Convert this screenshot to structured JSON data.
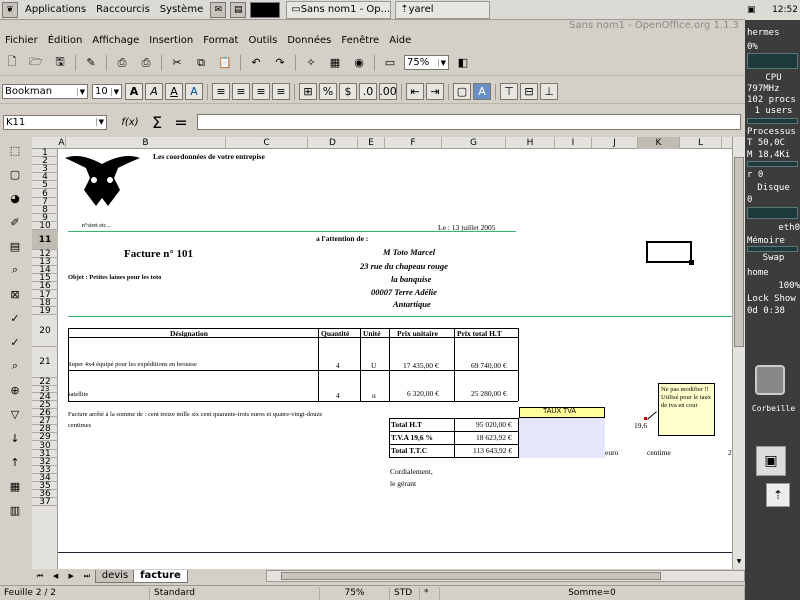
{
  "panel": {
    "menus": [
      "Applications",
      "Raccourcis",
      "Système"
    ],
    "tasks": [
      "Sans nom1 - Op...",
      "yarel"
    ],
    "clock": "12:52"
  },
  "window": {
    "title": "Sans nom1 - OpenOffice.org 1.1.3"
  },
  "menubar": [
    "Fichier",
    "Édition",
    "Affichage",
    "Insertion",
    "Format",
    "Outils",
    "Données",
    "Fenêtre",
    "Aide"
  ],
  "toolbar": {
    "zoom": "75%"
  },
  "format": {
    "font": "Bookman",
    "size": "10"
  },
  "formula": {
    "cellref": "K11",
    "func_label": "f(x)",
    "sigma": "Σ",
    "equals": "=",
    "content": ""
  },
  "columns": [
    "A",
    "B",
    "C",
    "D",
    "E",
    "F",
    "G",
    "H",
    "I",
    "J",
    "K",
    "L"
  ],
  "rows": [
    "1",
    "2",
    "3",
    "4",
    "5",
    "6",
    "7",
    "8",
    "9",
    "10",
    "11",
    "12",
    "13",
    "14",
    "15",
    "16",
    "17",
    "18",
    "19",
    "20",
    "21",
    "22",
    "23",
    "24",
    "25",
    "26",
    "27",
    "28",
    "29",
    "30",
    "31",
    "32",
    "33",
    "34",
    "35",
    "36",
    "37"
  ],
  "sheet": {
    "company": "Les coordonnées de votre entrepise",
    "small": "n°siret etc...",
    "date": "Le : 13 juillet 2005",
    "attention": "a l'attention de :",
    "invoice": "Facture n° 101",
    "client_name": "M Toto Marcel",
    "client_addr1": "23 rue du chapeau rouge",
    "client_addr2": "la banquise",
    "client_addr3": "00007  Terre Adélie",
    "client_addr4": "Antartique",
    "object": "Objet : Petites laines pour les toto",
    "headers": [
      "Désignation",
      "Quantité",
      "Unité",
      "Prix unitaire",
      "Prix total H.T"
    ],
    "items": [
      {
        "desc": "Super 4x4 équipé pour les expéditions en brousse",
        "qty": "4",
        "unit": "U",
        "price": "17 435,00 €",
        "total": "69 740,00 €"
      },
      {
        "desc": "satellite",
        "qty": "4",
        "unit": "u",
        "price": "6 320,00 €",
        "total": "25 280,00 €"
      }
    ],
    "amount_words_1": "Facture arrêté à la somme de :  cent treize mille six cent quarante-trois euros et  quatre-vingt-douze",
    "amount_words_2": "centimes",
    "totals": [
      {
        "label": "Total H.T",
        "value": "95 020,00 €"
      },
      {
        "label": "T.V.A  19,6 %",
        "value": "18 623,92 €"
      },
      {
        "label": "Total T.T.C",
        "value": "113 643,92 €"
      }
    ],
    "tva_header": "TAUX TVA",
    "tva_rate": "19,6",
    "euro": "euro",
    "centime": "centime",
    "l26": "2",
    "sign1": "Cordialement,",
    "sign2": "le gérant",
    "note": "Ne pas modifier !! Utilisé pour le taux de tva en cour"
  },
  "tabs": [
    "devis",
    "facture"
  ],
  "status": {
    "sheet": "Feuille 2 / 2",
    "style": "Standard",
    "zoom": "75%",
    "mode": "STD",
    "flag": "*",
    "sum": "Somme=0"
  },
  "side": {
    "host": "hermes",
    "cpu_pct": "0%",
    "cpu_label": "CPU",
    "cpu_mhz": "797MHz",
    "procs": "102 procs",
    "users": "1 users",
    "proc_label": "Processus",
    "temp": "T 50,0C",
    "mem": "M 18,4Ki",
    "r0": "r 0",
    "disk": "Disque",
    "d0": "0",
    "eth": "eth0",
    "mem_label": "Mémoire",
    "swap": "Swap",
    "home": "home",
    "home_pct": "100%",
    "lock": "Lock  Show",
    "uptime": "0d  0:38",
    "trash": "Corbeille"
  },
  "colors": {
    "accent_green": "#3cb371",
    "tva_header_bg": "#ffff99",
    "tva_cell_bg": "#e6e6fa",
    "note_bg": "#ffffcc"
  }
}
